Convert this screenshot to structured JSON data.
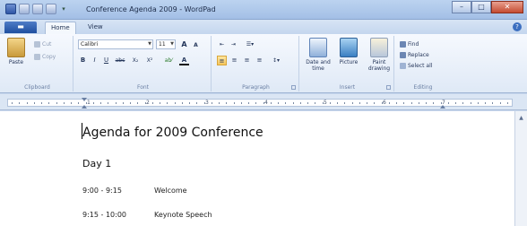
{
  "window": {
    "title": "Conference Agenda 2009 - WordPad",
    "minimize": "–",
    "maximize": "□",
    "close": "✕"
  },
  "tabs": {
    "file": "▬",
    "home": "Home",
    "view": "View",
    "help": "?"
  },
  "ribbon": {
    "clipboard": {
      "label": "Clipboard",
      "paste": "Paste",
      "cut": "Cut",
      "copy": "Copy"
    },
    "font": {
      "label": "Font",
      "family": "Calibri",
      "size": "11",
      "grow": "A",
      "shrink": "A",
      "bold": "B",
      "italic": "I",
      "underline": "U",
      "strike": "abc",
      "subscript": "X₂",
      "superscript": "X²",
      "highlight": "ab⁄",
      "color": "A"
    },
    "paragraph": {
      "label": "Paragraph"
    },
    "insert": {
      "label": "Insert",
      "datetime": "Date and time",
      "picture": "Picture",
      "paint": "Paint drawing"
    },
    "editing": {
      "label": "Editing",
      "find": "Find",
      "replace": "Replace",
      "select_all": "Select all"
    }
  },
  "ruler": {
    "numbers": [
      "1",
      "2",
      "3",
      "4",
      "5",
      "6",
      "7"
    ]
  },
  "document": {
    "title": "Agenda for 2009 Conference",
    "day": "Day 1",
    "rows": [
      {
        "time": "9:00 - 9:15",
        "item": "Welcome"
      },
      {
        "time": "9:15 - 10:00",
        "item": "Keynote Speech"
      }
    ]
  },
  "colors": {
    "titlebar": "#a3bfe6",
    "file_tab": "#2f5ea9",
    "ribbon": "#dfe9f6",
    "page": "#ffffff"
  }
}
